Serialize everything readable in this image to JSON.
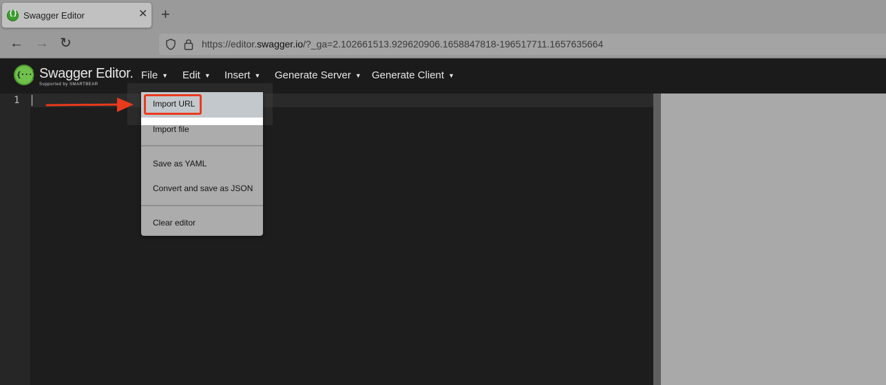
{
  "browser": {
    "tab": {
      "title": "Swagger Editor",
      "close_glyph": "✕",
      "favicon": "swagger-favicon-icon"
    },
    "new_tab_glyph": "+",
    "nav": {
      "back": "←",
      "forward": "→",
      "reload": "↻"
    },
    "address": {
      "prefix": "https://editor.",
      "host": "swagger.io",
      "suffix": "/?_ga=2.102661513.929620906.1658847818-196517711.1657635664"
    }
  },
  "app": {
    "logo_title": "Swagger Editor.",
    "logo_subtitle": "Supported by SMARTBEAR",
    "menu": [
      {
        "label": "File",
        "caret": "▼"
      },
      {
        "label": "Edit",
        "caret": "▼"
      },
      {
        "label": "Insert",
        "caret": "▼"
      },
      {
        "label": "Generate Server",
        "caret": "▼"
      },
      {
        "label": "Generate Client",
        "caret": "▼"
      }
    ]
  },
  "file_menu": {
    "items": [
      {
        "label": "Import URL",
        "highlighted": true
      },
      {
        "label": "Import file"
      },
      {
        "label": "Save as YAML"
      },
      {
        "label": "Convert and save as JSON"
      },
      {
        "label": "Clear editor"
      }
    ]
  },
  "editor": {
    "line_number": "1"
  },
  "colors": {
    "annotation": "#ea3a1c",
    "swagger_green": "#6fc14b",
    "topbar": "#1b1b1b"
  }
}
